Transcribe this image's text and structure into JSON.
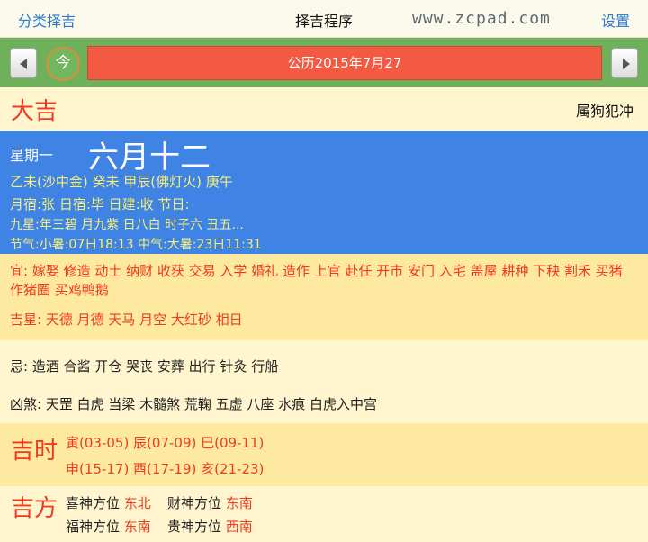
{
  "header": {
    "left_label": "分类择吉",
    "title": "择吉程序",
    "watermark": "www.zcpad.com",
    "right_label": "设置"
  },
  "datebar": {
    "today_label": "今",
    "date": "公历2015年7月27"
  },
  "day": {
    "level": "大吉",
    "clash": "属狗犯冲",
    "weekday": "星期一",
    "lunar_date": "六月十二",
    "ganzhi": "乙未(沙中金) 癸未 甲辰(佛灯火) 庚午",
    "constellations": "月宿:张 日宿:毕 日建:收  节日:",
    "stars": "九星:年三碧 月九紫 日八白 时子六 丑五...",
    "solar_terms": "节气:小暑:07日18:13 中气:大暑:23日11:31"
  },
  "suitable": {
    "yi": "宜: 嫁娶 修造 动土 纳财 收获 交易 入学 婚礼 造作 上官 赴任 开市 安门 入宅 盖屋 耕种 下秧 割禾 买猪 作猪圈 买鸡鸭鹅",
    "ji_stars": "吉星: 天德 月德 天马 月空 大红砂 相日"
  },
  "avoid": {
    "ji": "忌: 造酒 合酱 开仓 哭丧 安葬 出行 针灸 行船",
    "xiong_sha": "凶煞: 天罡 白虎 当梁 木髓煞 荒鞠 五虚 八座 水痕 白虎入中宫"
  },
  "good_hours": {
    "title": "吉时",
    "row1": "寅(03-05) 辰(07-09) 巳(09-11)",
    "row2": "申(15-17) 酉(17-19) 亥(21-23)"
  },
  "good_directions": {
    "title": "吉方",
    "items": [
      {
        "label": "喜神方位",
        "value": "东北"
      },
      {
        "label": "财神方位",
        "value": "东南"
      },
      {
        "label": "福神方位",
        "value": "东南"
      },
      {
        "label": "贵神方位",
        "value": "西南"
      }
    ]
  },
  "colors": {
    "accent_red": "#f03a1e",
    "date_box": "#f35a42",
    "bar_green": "#6fb15a",
    "info_blue": "#3f83e5",
    "link_blue": "#2a7ad1"
  }
}
